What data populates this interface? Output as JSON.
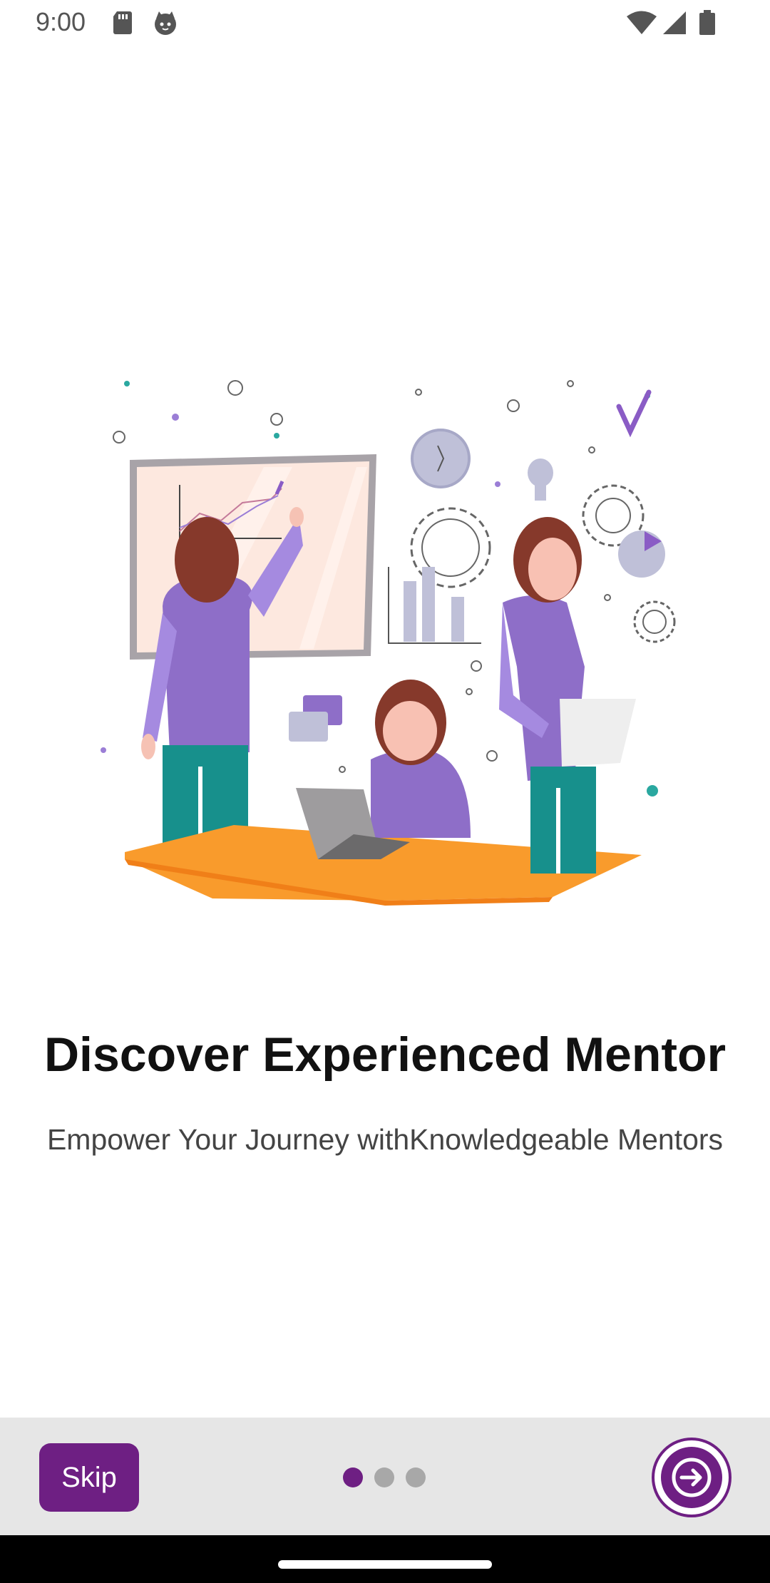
{
  "status_bar": {
    "time": "9:00",
    "icons": [
      "sd-card-icon",
      "cat-icon",
      "wifi-icon",
      "signal-icon",
      "battery-icon"
    ]
  },
  "onboarding": {
    "illustration": "mentoring-team-illustration",
    "title": "Discover Experienced Mentor",
    "subtitle": "Empower Your Journey withKnowledgeable Mentors"
  },
  "bottom_bar": {
    "skip_label": "Skip",
    "page_indicator": {
      "current": 1,
      "total": 3
    },
    "next_icon": "arrow-right-icon"
  },
  "colors": {
    "primary": "#6e1f83",
    "dot_inactive": "#a8a8a8",
    "bottom_bar_bg": "#e6e6e6"
  }
}
